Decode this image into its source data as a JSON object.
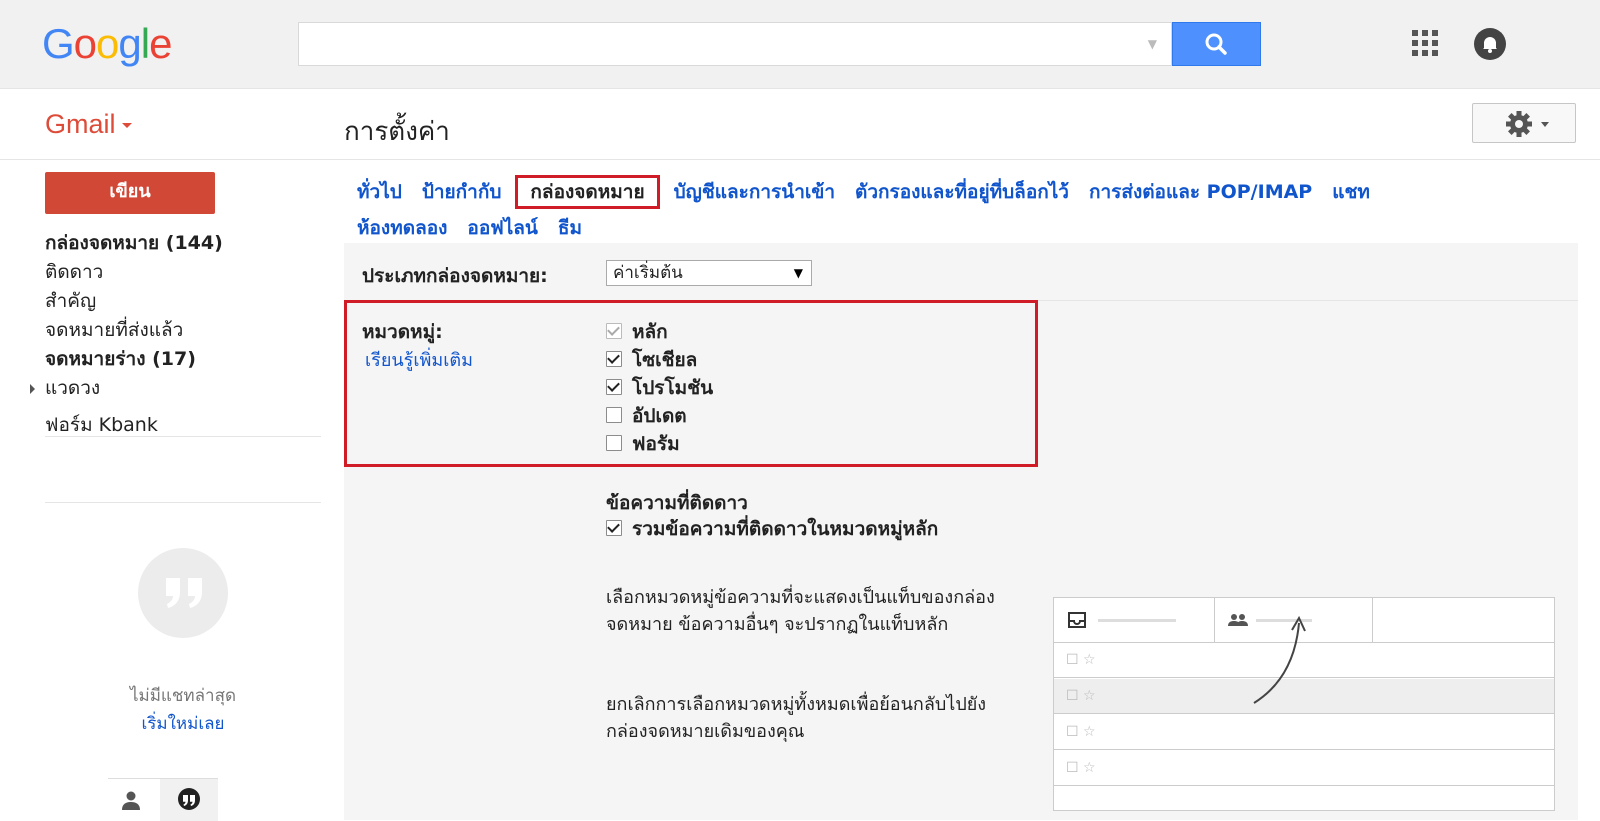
{
  "header": {
    "logo": [
      "G",
      "o",
      "o",
      "g",
      "l",
      "e"
    ],
    "logo_colors": [
      "#4285f4",
      "#ea4335",
      "#fbbc05",
      "#4285f4",
      "#34a853",
      "#ea4335"
    ],
    "search_placeholder": ""
  },
  "subbar": {
    "gmail_label": "Gmail",
    "page_title": "การตั้งค่า"
  },
  "sidebar": {
    "compose_label": "เขียน",
    "items": [
      {
        "label": "กล่องจดหมาย (144)",
        "bold": true
      },
      {
        "label": "ติดดาว",
        "bold": false
      },
      {
        "label": "สำคัญ",
        "bold": false
      },
      {
        "label": "จดหมายที่ส่งแล้ว",
        "bold": false
      },
      {
        "label": "จดหมายร่าง (17)",
        "bold": true
      },
      {
        "label": "แวดวง",
        "bold": false
      },
      {
        "label": "ฟอร์ม Kbank",
        "bold": false
      }
    ],
    "no_chat": "ไม่มีแชทล่าสุด",
    "start_chat": "เริ่มใหม่เลย"
  },
  "settings_tabs": [
    {
      "label": "ทั่วไป",
      "active": false
    },
    {
      "label": "ป้ายกำกับ",
      "active": false
    },
    {
      "label": "กล่องจดหมาย",
      "active": true
    },
    {
      "label": "บัญชีและการนำเข้า",
      "active": false
    },
    {
      "label": "ตัวกรองและที่อยู่ที่บล็อกไว้",
      "active": false
    },
    {
      "label": "การส่งต่อและ POP/IMAP",
      "active": false
    },
    {
      "label": "แชท",
      "active": false
    },
    {
      "label": "ห้องทดลอง",
      "active": false
    },
    {
      "label": "ออฟไลน์",
      "active": false
    },
    {
      "label": "ธีม",
      "active": false
    }
  ],
  "inbox_type": {
    "label": "ประเภทกล่องจดหมาย:",
    "selected": "ค่าเริ่มต้น"
  },
  "categories": {
    "label": "หมวดหมู่:",
    "learn_more": "เรียนรู้เพิ่มเติม",
    "options": [
      {
        "label": "หลัก",
        "checked": true,
        "disabled": true
      },
      {
        "label": "โซเชียล",
        "checked": true,
        "disabled": false
      },
      {
        "label": "โปรโมชัน",
        "checked": true,
        "disabled": false
      },
      {
        "label": "อัปเดต",
        "checked": false,
        "disabled": false
      },
      {
        "label": "ฟอรัม",
        "checked": false,
        "disabled": false
      }
    ]
  },
  "starred": {
    "heading": "ข้อความที่ติดดาว",
    "option_label": "รวมข้อความที่ติดดาวในหมวดหมู่หลัก",
    "checked": true
  },
  "description": {
    "para1": "เลือกหมวดหมู่ข้อความที่จะแสดงเป็นแท็บของกล่องจดหมาย ข้อความอื่นๆ จะปรากฏในแท็บหลัก",
    "para2": "ยกเลิกการเลือกหมวดหมู่ทั้งหมดเพื่อย้อนกลับไปยังกล่องจดหมายเดิมของคุณ"
  },
  "preview": {
    "rows": [
      "☐ ☆",
      "☐ ☆",
      "☐ ☆",
      "☐ ☆"
    ]
  },
  "colors": {
    "accent_link": "#1155cc",
    "compose_red": "#d14836",
    "highlight_red": "#d01c27",
    "search_blue": "#4d90fe"
  }
}
